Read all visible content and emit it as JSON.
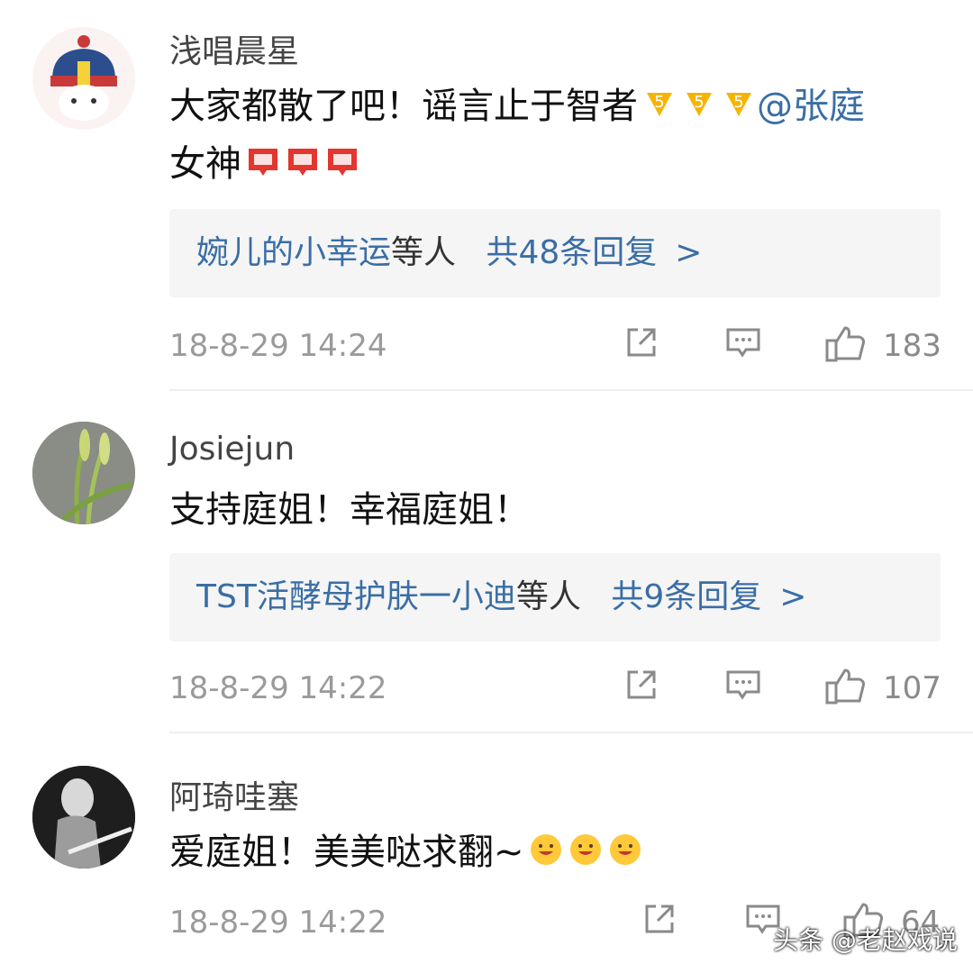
{
  "comments": [
    {
      "username": "浅唱晨星",
      "text_line1": "大家都散了吧！谣言止于智者",
      "mention": "@张庭",
      "text_line2": "女神",
      "reply_prefix": "婉儿的小幸运",
      "reply_suffix": "等人",
      "reply_count": "共48条回复",
      "chevron": ">",
      "time": "18-8-29 14:24",
      "likes": "183"
    },
    {
      "username": "Josiejun",
      "text": "支持庭姐！幸福庭姐！",
      "reply_prefix": "TST活酵母护肤一小迪",
      "reply_suffix": "等人",
      "reply_count": "共9条回复",
      "chevron": ">",
      "time": "18-8-29 14:22",
      "likes": "107"
    },
    {
      "username": "阿琦哇塞",
      "text": "爱庭姐！美美哒求翻~",
      "time": "18-8-29 14:22",
      "likes": "64"
    }
  ],
  "watermark": "头条 @老赵戏说",
  "icons": [
    "share-icon",
    "comment-icon",
    "like-icon",
    "emoji-5-icon",
    "emoji-fight-icon",
    "emoji-smile-icon"
  ],
  "colors": {
    "mention": "#3a6ea5",
    "meta": "#9a9a9a",
    "reply_bg": "#f5f5f5"
  }
}
